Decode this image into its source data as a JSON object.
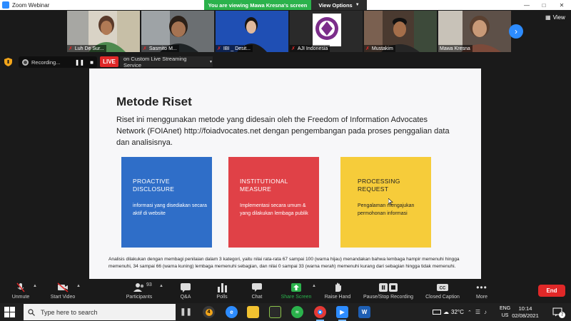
{
  "window": {
    "title": "Zoom Webinar",
    "sharing_banner": "You are viewing Mawa Kresna's screen",
    "view_options_label": "View Options"
  },
  "gallery": {
    "view_label": "View",
    "participants": [
      {
        "name": "Luh De Sur...",
        "muted": true
      },
      {
        "name": "Sasmito M...",
        "muted": true
      },
      {
        "name": "IBI _ Desit...",
        "muted": true
      },
      {
        "name": "AJI Indonesia",
        "muted": true
      },
      {
        "name": "Mustakim",
        "muted": true
      },
      {
        "name": "Mawa Kresna",
        "muted": false,
        "active": true
      }
    ]
  },
  "recording": {
    "label": "Recording...",
    "live_badge": "LIVE",
    "live_service": "on Custom Live Streaming Service"
  },
  "slide": {
    "title": "Metode Riset",
    "intro": "Riset ini menggunakan metode yang didesain oleh the Freedom of Information Advocates Network (FOIAnet) http://foiadvocates.net dengan pengembangan pada proses penggalian data dan analisisnya.",
    "cards": [
      {
        "title_line1": "PROACTIVE",
        "title_line2": "DISCLOSURE",
        "body": "informasi yang disediakan secara aktif di website",
        "color": "#2f6ec8"
      },
      {
        "title_line1": "INSTITUTIONAL",
        "title_line2": "MEASURE",
        "body": "Implementasi secara umum & yang dilakukan lembaga publik",
        "color": "#e04147"
      },
      {
        "title_line1": "PROCESSING",
        "title_line2": "REQUEST",
        "body": "Pengalaman mengajukan permohonan informasi",
        "color": "#f6cc3a"
      }
    ],
    "note": "Analisis dilakukan dengan membagi penilaian dalam 3 kategori, yaitu nilai rata-rata 67 sampai 100 (warna hijau) menandakan bahwa lembaga hampir memenuhi hingga memenuhi, 34 sampai 66 (warna kuning) lembaga memenuhi sebagian, dan nilai 0 sampai 33 (warna merah) memenuhi kurang dari sebagian hingga tidak memenuhi."
  },
  "toolbar": {
    "unmute": "Unmute",
    "start_video": "Start Video",
    "participants": "Participants",
    "participants_count": "93",
    "qa": "Q&A",
    "polls": "Polls",
    "chat": "Chat",
    "share_screen": "Share Screen",
    "raise_hand": "Raise Hand",
    "pause_stop_recording": "Pause/Stop Recording",
    "closed_caption": "Closed Caption",
    "more": "More",
    "end": "End"
  },
  "taskbar": {
    "search_placeholder": "Type here to search",
    "zoom_badge": "4",
    "temperature": "32°C",
    "lang_line1": "ENG",
    "lang_line2": "US",
    "time": "10:14",
    "date": "02/08/2021",
    "notification_count": "7"
  },
  "colors": {
    "accent_green": "#2bb24c",
    "zoom_blue": "#2d8cff",
    "end_red": "#e02828"
  }
}
